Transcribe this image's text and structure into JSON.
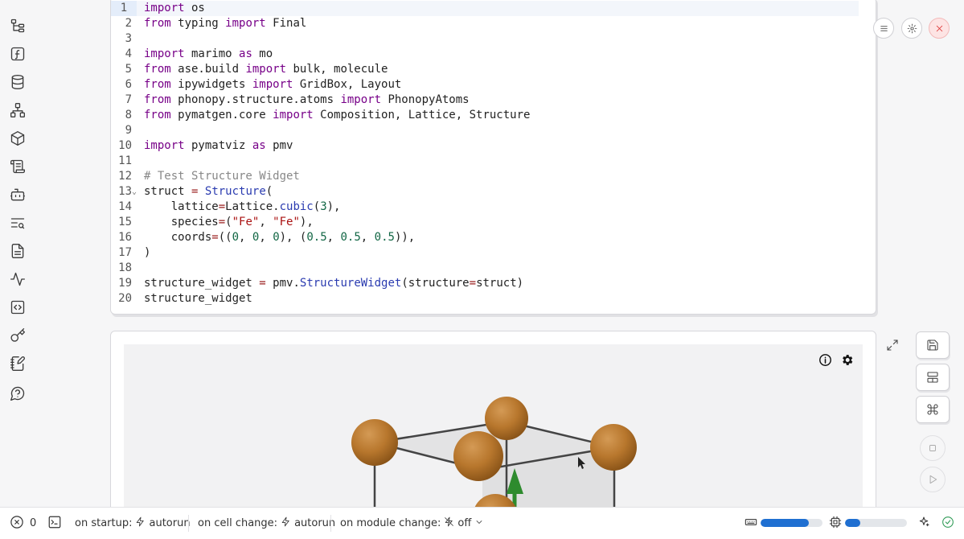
{
  "sidebar": {
    "items": [
      {
        "icon": "file-tree-icon"
      },
      {
        "icon": "function-icon"
      },
      {
        "icon": "database-icon"
      },
      {
        "icon": "network-icon"
      },
      {
        "icon": "package-icon"
      },
      {
        "icon": "scroll-icon"
      },
      {
        "icon": "bot-icon"
      },
      {
        "icon": "text-search-icon"
      },
      {
        "icon": "document-icon"
      },
      {
        "icon": "activity-icon"
      },
      {
        "icon": "code-square-icon"
      },
      {
        "icon": "key-icon"
      },
      {
        "icon": "notebook-pen-icon"
      },
      {
        "icon": "help-icon"
      }
    ]
  },
  "editor": {
    "active_line": 1,
    "lines": [
      {
        "n": "1",
        "html": "<span class='kw'>import</span> os"
      },
      {
        "n": "2",
        "html": "<span class='kw'>from</span> typing <span class='kw'>import</span> Final"
      },
      {
        "n": "3",
        "html": ""
      },
      {
        "n": "4",
        "html": "<span class='kw'>import</span> marimo <span class='kw'>as</span> mo"
      },
      {
        "n": "5",
        "html": "<span class='kw'>from</span> ase.build <span class='kw'>import</span> bulk, molecule"
      },
      {
        "n": "6",
        "html": "<span class='kw'>from</span> ipywidgets <span class='kw'>import</span> GridBox, Layout"
      },
      {
        "n": "7",
        "html": "<span class='kw'>from</span> phonopy.structure.atoms <span class='kw'>import</span> PhonopyAtoms"
      },
      {
        "n": "8",
        "html": "<span class='kw'>from</span> pymatgen.core <span class='kw'>import</span> Composition, Lattice, Structure"
      },
      {
        "n": "9",
        "html": ""
      },
      {
        "n": "10",
        "html": "<span class='kw'>import</span> pymatviz <span class='kw'>as</span> pmv"
      },
      {
        "n": "11",
        "html": ""
      },
      {
        "n": "12",
        "html": "<span class='cm'># Test Structure Widget</span>"
      },
      {
        "n": "13",
        "html": "struct <span class='op'>=</span> <span class='cls'>Structure</span>(",
        "fold": true
      },
      {
        "n": "14",
        "html": "    lattice<span class='op'>=</span>Lattice.<span class='cls'>cubic</span>(<span class='num'>3</span>),"
      },
      {
        "n": "15",
        "html": "    species<span class='op'>=</span>(<span class='str'>\"Fe\"</span>, <span class='str'>\"Fe\"</span>),"
      },
      {
        "n": "16",
        "html": "    coords<span class='op'>=</span>((<span class='num'>0</span>, <span class='num'>0</span>, <span class='num'>0</span>), (<span class='num'>0.5</span>, <span class='num'>0.5</span>, <span class='num'>0.5</span>)),"
      },
      {
        "n": "17",
        "html": ")"
      },
      {
        "n": "18",
        "html": ""
      },
      {
        "n": "19",
        "html": "structure_widget <span class='op'>=</span> pmv.<span class='cls'>StructureWidget</span>(structure<span class='op'>=</span>struct)"
      },
      {
        "n": "20",
        "html": "structure_widget"
      }
    ]
  },
  "cell_actions": [
    "menu-icon",
    "settings-icon",
    "close-icon"
  ],
  "viewer": {
    "atom_color": "#b8772d",
    "arrow_color": "#2e8b2e",
    "info_icon": "info-icon",
    "settings_icon": "gear-icon"
  },
  "right_tools": [
    "save-icon",
    "layout-icon",
    "command-icon",
    "stop-icon",
    "run-icon"
  ],
  "footer": {
    "error_count": "0",
    "on_startup_label": "on startup:",
    "on_startup_value": "autorun",
    "on_cell_change_label": "on cell change:",
    "on_cell_change_value": "autorun",
    "on_module_change_label": "on module change:",
    "on_module_change_value": "off",
    "memory_usage": 0.78,
    "cpu_usage": 0.25
  }
}
